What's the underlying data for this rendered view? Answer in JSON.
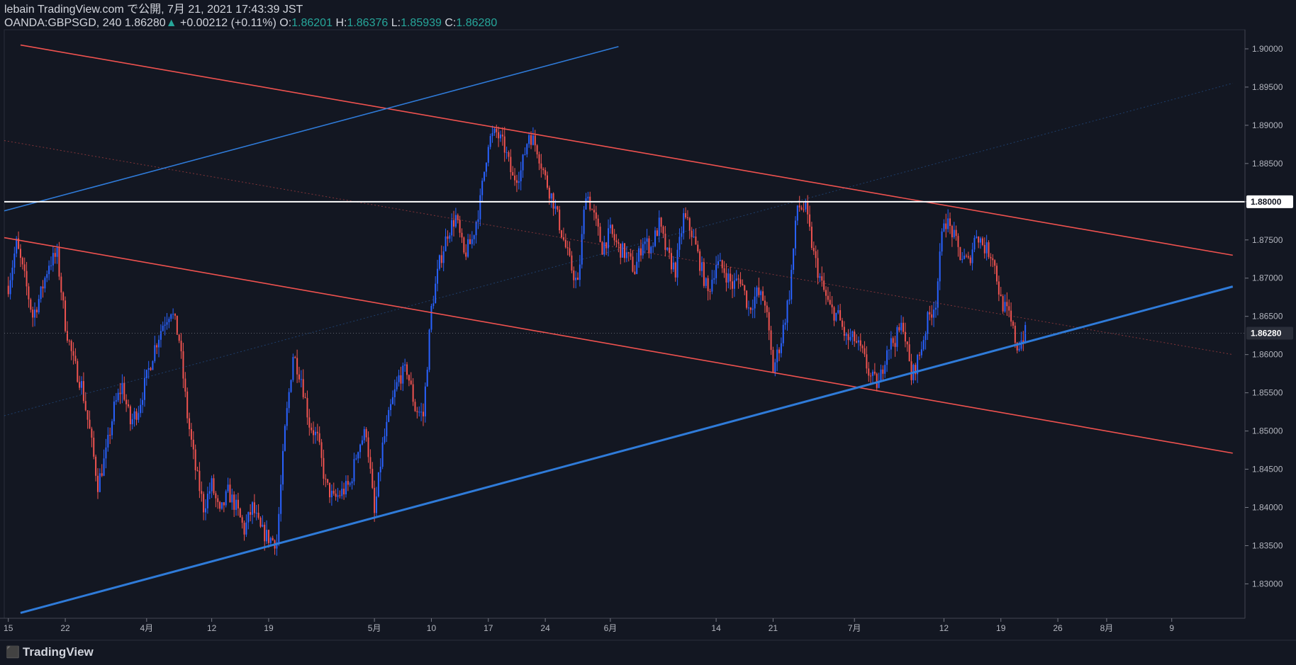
{
  "header": {
    "publish_line": "lebain TradingView.com で公開, 7月 21, 2021 17:43:39 JST",
    "symbol": "OANDA:GBPSGD, 240",
    "last": "1.86280",
    "change": "+0.00212 (+0.11%)",
    "o_label": "O:",
    "o": "1.86201",
    "h_label": "H:",
    "h": "1.86376",
    "l_label": "L:",
    "l": "1.85939",
    "c_label": "C:",
    "c": "1.86280"
  },
  "footer": {
    "logo": "TradingView"
  },
  "colors": {
    "background": "#131722",
    "up": "#2962ff",
    "down": "#ef5350",
    "trend_red": "#f0524f",
    "trend_blue": "#2f7bd9",
    "hline": "#ffffff",
    "axis_text": "#b2b5be"
  },
  "chart_data": {
    "type": "candlestick",
    "symbol": "OANDA:GBPSGD",
    "timeframe": "240",
    "ylim": [
      1.8255,
      1.9025
    ],
    "y_ticks": [
      "1.90000",
      "1.89500",
      "1.89000",
      "1.88500",
      "1.88000",
      "1.87500",
      "1.87000",
      "1.86500",
      "1.86000",
      "1.85500",
      "1.85000",
      "1.84500",
      "1.84000",
      "1.83500",
      "1.83000"
    ],
    "x_ticks": [
      {
        "label": "15",
        "x": 0
      },
      {
        "label": "22",
        "x": 7
      },
      {
        "label": "4月",
        "x": 17
      },
      {
        "label": "12",
        "x": 25
      },
      {
        "label": "19",
        "x": 32
      },
      {
        "label": "5月",
        "x": 45
      },
      {
        "label": "10",
        "x": 52
      },
      {
        "label": "17",
        "x": 59
      },
      {
        "label": "24",
        "x": 66
      },
      {
        "label": "6月",
        "x": 74
      },
      {
        "label": "14",
        "x": 87
      },
      {
        "label": "21",
        "x": 94
      },
      {
        "label": "7月",
        "x": 104
      },
      {
        "label": "12",
        "x": 115
      },
      {
        "label": "19",
        "x": 122
      },
      {
        "label": "26",
        "x": 129
      },
      {
        "label": "8月",
        "x": 135
      },
      {
        "label": "9",
        "x": 143
      }
    ],
    "x_range": [
      -0.5,
      152
    ],
    "last_price": 1.8628,
    "horizontal_line": 1.88,
    "close_path": [
      [
        0,
        1.869
      ],
      [
        1,
        1.8745
      ],
      [
        2,
        1.87
      ],
      [
        3,
        1.865
      ],
      [
        4,
        1.868
      ],
      [
        5,
        1.872
      ],
      [
        6,
        1.873
      ],
      [
        7,
        1.864
      ],
      [
        8,
        1.859
      ],
      [
        9,
        1.856
      ],
      [
        10,
        1.85
      ],
      [
        11,
        1.843
      ],
      [
        12,
        1.847
      ],
      [
        13,
        1.853
      ],
      [
        14,
        1.856
      ],
      [
        15,
        1.851
      ],
      [
        16,
        1.853
      ],
      [
        17,
        1.857
      ],
      [
        18,
        1.861
      ],
      [
        19,
        1.864
      ],
      [
        20,
        1.866
      ],
      [
        21,
        1.862
      ],
      [
        22,
        1.852
      ],
      [
        23,
        1.845
      ],
      [
        24,
        1.84
      ],
      [
        25,
        1.843
      ],
      [
        26,
        1.839
      ],
      [
        27,
        1.842
      ],
      [
        28,
        1.84
      ],
      [
        29,
        1.837
      ],
      [
        30,
        1.84
      ],
      [
        31,
        1.837
      ],
      [
        32,
        1.836
      ],
      [
        33,
        1.8355
      ],
      [
        34,
        1.85
      ],
      [
        35,
        1.86
      ],
      [
        36,
        1.857
      ],
      [
        37,
        1.851
      ],
      [
        38,
        1.849
      ],
      [
        39,
        1.843
      ],
      [
        40,
        1.841
      ],
      [
        41,
        1.842
      ],
      [
        42,
        1.843
      ],
      [
        43,
        1.848
      ],
      [
        44,
        1.85
      ],
      [
        45,
        1.839
      ],
      [
        46,
        1.848
      ],
      [
        47,
        1.853
      ],
      [
        48,
        1.857
      ],
      [
        49,
        1.858
      ],
      [
        50,
        1.853
      ],
      [
        51,
        1.852
      ],
      [
        52,
        1.866
      ],
      [
        53,
        1.872
      ],
      [
        54,
        1.876
      ],
      [
        55,
        1.878
      ],
      [
        56,
        1.873
      ],
      [
        57,
        1.875
      ],
      [
        58,
        1.88
      ],
      [
        59,
        1.888
      ],
      [
        60,
        1.889
      ],
      [
        61,
        1.887
      ],
      [
        62,
        1.883
      ],
      [
        63,
        1.884
      ],
      [
        64,
        1.889
      ],
      [
        65,
        1.887
      ],
      [
        66,
        1.883
      ],
      [
        67,
        1.88
      ],
      [
        68,
        1.876
      ],
      [
        69,
        1.872
      ],
      [
        70,
        1.869
      ],
      [
        71,
        1.8815
      ],
      [
        72,
        1.878
      ],
      [
        73,
        1.874
      ],
      [
        74,
        1.876
      ],
      [
        75,
        1.874
      ],
      [
        76,
        1.873
      ],
      [
        77,
        1.871
      ],
      [
        78,
        1.875
      ],
      [
        79,
        1.874
      ],
      [
        80,
        1.877
      ],
      [
        81,
        1.873
      ],
      [
        82,
        1.871
      ],
      [
        83,
        1.878
      ],
      [
        84,
        1.876
      ],
      [
        85,
        1.872
      ],
      [
        86,
        1.868
      ],
      [
        87,
        1.872
      ],
      [
        88,
        1.871
      ],
      [
        89,
        1.869
      ],
      [
        90,
        1.87
      ],
      [
        91,
        1.866
      ],
      [
        92,
        1.868
      ],
      [
        93,
        1.867
      ],
      [
        94,
        1.858
      ],
      [
        95,
        1.862
      ],
      [
        96,
        1.868
      ],
      [
        97,
        1.8795
      ],
      [
        98,
        1.879
      ],
      [
        99,
        1.873
      ],
      [
        100,
        1.869
      ],
      [
        101,
        1.866
      ],
      [
        102,
        1.865
      ],
      [
        103,
        1.862
      ],
      [
        104,
        1.862
      ],
      [
        105,
        1.86
      ],
      [
        106,
        1.857
      ],
      [
        107,
        1.856
      ],
      [
        108,
        1.861
      ],
      [
        109,
        1.862
      ],
      [
        110,
        1.864
      ],
      [
        111,
        1.857
      ],
      [
        112,
        1.86
      ],
      [
        113,
        1.8645
      ],
      [
        114,
        1.867
      ],
      [
        115,
        1.878
      ],
      [
        116,
        1.876
      ],
      [
        117,
        1.873
      ],
      [
        118,
        1.872
      ],
      [
        119,
        1.876
      ],
      [
        120,
        1.874
      ],
      [
        121,
        1.873
      ],
      [
        122,
        1.867
      ],
      [
        123,
        1.865
      ],
      [
        124,
        1.861
      ],
      [
        125,
        1.8628
      ]
    ],
    "trendlines": [
      {
        "name": "red-channel-upper",
        "color": "#f0524f",
        "width": 1.6,
        "points": [
          [
            1.5,
            1.9005
          ],
          [
            150.5,
            1.873
          ]
        ]
      },
      {
        "name": "red-channel-lower",
        "color": "#f0524f",
        "width": 1.6,
        "points": [
          [
            -0.5,
            1.8753
          ],
          [
            150.5,
            1.8471
          ]
        ]
      },
      {
        "name": "red-midline",
        "color": "#f0524f",
        "width": 1,
        "dash": "2,3",
        "opacity": 0.5,
        "points": [
          [
            -0.5,
            1.888
          ],
          [
            150.5,
            1.86
          ]
        ]
      },
      {
        "name": "blue-rising-upper",
        "color": "#2f7bd9",
        "width": 1.6,
        "points": [
          [
            -0.5,
            1.8788
          ],
          [
            75,
            1.9003
          ]
        ]
      },
      {
        "name": "blue-support",
        "color": "#2f7bd9",
        "width": 3,
        "points": [
          [
            1.5,
            1.8262
          ],
          [
            150.5,
            1.8689
          ]
        ]
      },
      {
        "name": "blue-faint-diagonal",
        "color": "#2f7bd9",
        "width": 1,
        "dash": "2,3",
        "opacity": 0.4,
        "points": [
          [
            -0.5,
            1.852
          ],
          [
            150.5,
            1.8955
          ]
        ]
      }
    ]
  }
}
